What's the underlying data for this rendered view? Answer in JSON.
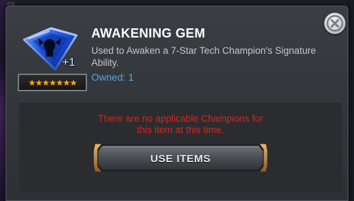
{
  "item": {
    "name": "AWAKENING GEM",
    "description": "Used to Awaken a 7-Star Tech Champion's Signature Ability.",
    "owned_label": "Owned:",
    "owned_count": "1",
    "quantity_badge": "+1",
    "star_rating": 7,
    "stars_text": "★★★★★★★",
    "icon": "awakening-gem-icon"
  },
  "message": {
    "warning_line1": "There are no applicable Champions for",
    "warning_line2": "this item at this time."
  },
  "actions": {
    "use_items_label": "USE ITEMS",
    "close_icon": "close-icon"
  },
  "background": {
    "partial_text": "ea"
  },
  "colors": {
    "title": "#ffffff",
    "description": "#c4c8cc",
    "owned": "#4fa8e8",
    "warning": "#d8261c",
    "stars": "#f6a51d",
    "gem": "#1a4fd6"
  }
}
